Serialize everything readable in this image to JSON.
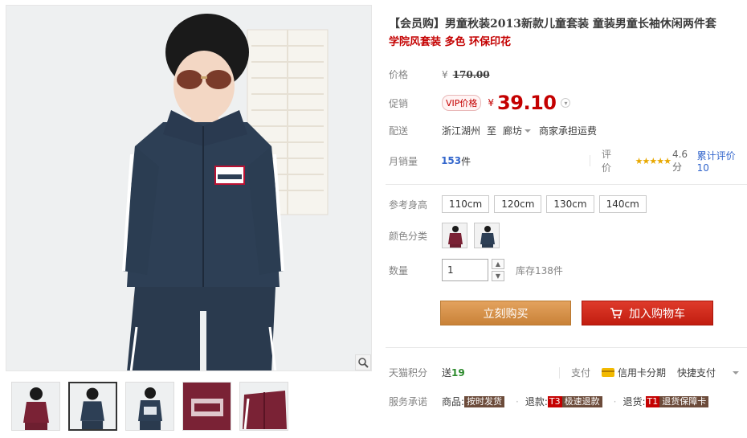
{
  "product": {
    "title": "【会员购】男童秋装2013新款儿童套装 童装男童长袖休闲两件套",
    "subtitle": "学院风套装 多色 环保印花"
  },
  "pricing": {
    "orig_label": "价格",
    "orig_currency": "¥",
    "orig_price": "170.00",
    "promo_label": "促销",
    "vip_badge": "VIP价格",
    "promo_currency": "¥",
    "promo_price": "39.10"
  },
  "shipping": {
    "label": "配送",
    "from": "浙江湖州",
    "to_word": "至",
    "destination": "廊坊",
    "fee_note": "商家承担运费"
  },
  "sales": {
    "label": "月销量",
    "count": "153",
    "unit": "件",
    "rating_label": "评价",
    "stars": "★★★★★",
    "score_text": "4.6分",
    "reviews_text": "累计评价10"
  },
  "options": {
    "size_label": "参考身高",
    "sizes": [
      "110cm",
      "120cm",
      "130cm",
      "140cm"
    ],
    "color_label": "颜色分类",
    "qty_label": "数量",
    "qty_value": "1",
    "stock_text": "库存138件"
  },
  "actions": {
    "buy_label": "立刻购买",
    "cart_label": "加入购物车"
  },
  "points": {
    "label": "天猫积分",
    "prefix": "送",
    "value": "19",
    "pay_label": "支付",
    "card_installment": "信用卡分期",
    "quick_pay": "快捷支付"
  },
  "service": {
    "label": "服务承诺",
    "items": [
      {
        "prefix": "商品:",
        "tag": "按时发货",
        "code": ""
      },
      {
        "prefix": "退款:",
        "tag": "极速退款",
        "code": "T3"
      },
      {
        "prefix": "退货:",
        "tag": "退货保障卡",
        "code": "T1"
      }
    ]
  },
  "colors": {
    "accent_red": "#c40000",
    "buy_orange": "#d8934b",
    "cart_red": "#c9241a",
    "navy": "#2d3f55",
    "maroon": "#7a2235"
  },
  "icons": [
    "zoom-icon",
    "cart-icon",
    "card-icon",
    "chevron-down-icon"
  ]
}
